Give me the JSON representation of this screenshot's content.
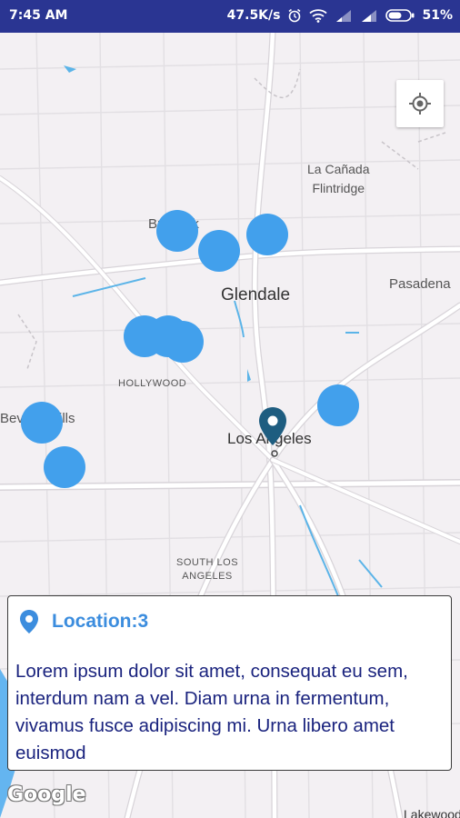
{
  "status_bar": {
    "time": "7:45 AM",
    "network_speed": "47.5K/s",
    "battery": "51%",
    "icons": [
      "alarm-icon",
      "wifi-icon",
      "signal-icon",
      "signal-icon",
      "battery-icon"
    ]
  },
  "map": {
    "labels": {
      "glendale": "Glendale",
      "la_canada": "La Cañada",
      "flintridge": "Flintridge",
      "pasadena": "Pasadena",
      "burbank": "Burbank",
      "hollywood": "HOLLYWOOD",
      "beverly_hills": "Beverly Hills",
      "los_angeles": "Los Angeles",
      "south_los": "SOUTH LOS",
      "angeles": "ANGELES",
      "lakewood": "Lakewood"
    },
    "cluster_color": "#42a0ec",
    "pin_color": "#1e5d80",
    "attribution": "Google"
  },
  "info_card": {
    "title": "Location:3",
    "description": "Lorem ipsum dolor sit amet, consequat eu sem, interdum nam a vel. Diam urna in fermentum, vivamus fusce adipiscing mi. Urna libero amet euismod"
  },
  "colors": {
    "status_bar": "#2a3592",
    "title": "#3c8dde",
    "body_text": "#1a237e"
  }
}
